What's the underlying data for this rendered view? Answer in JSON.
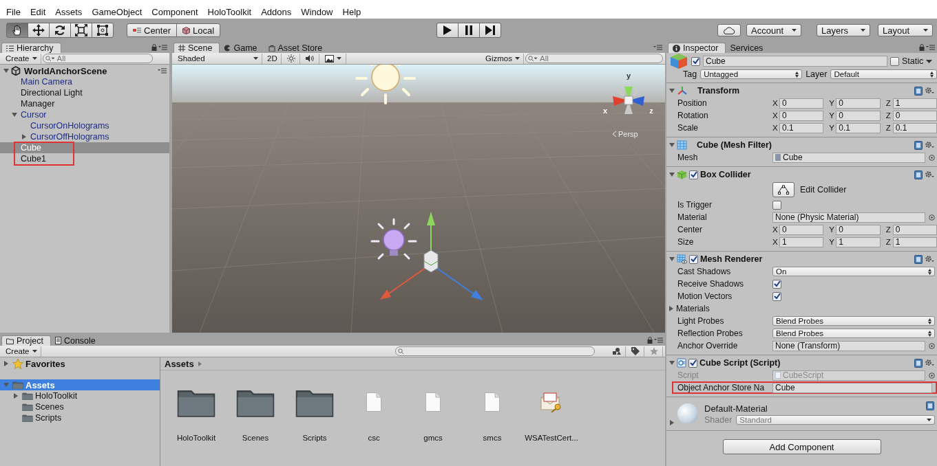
{
  "menu": [
    "File",
    "Edit",
    "Assets",
    "GameObject",
    "Component",
    "HoloToolkit",
    "Addons",
    "Window",
    "Help"
  ],
  "toolbar": {
    "tools": [
      {
        "kind": "hand",
        "selected": true
      },
      {
        "kind": "move",
        "selected": false
      },
      {
        "kind": "rotate",
        "selected": false
      },
      {
        "kind": "scale",
        "selected": false
      },
      {
        "kind": "rect",
        "selected": false
      }
    ],
    "pivot_buttons": [
      {
        "kind": "pivot",
        "label": "Center"
      },
      {
        "kind": "space",
        "label": "Local"
      }
    ],
    "playback": [
      {
        "kind": "play"
      },
      {
        "kind": "pause"
      },
      {
        "kind": "step"
      }
    ],
    "menus": [
      "Account",
      "Layers",
      "Layout"
    ]
  },
  "hierarchy": {
    "tab": "Hierarchy",
    "create": "Create",
    "search_placeholder": "All",
    "scene": "WorldAnchorScene",
    "items": [
      {
        "name": "Main Camera",
        "kind": "prefab",
        "selected": false,
        "outlined": false
      },
      {
        "name": "Directional Light",
        "kind": "object",
        "selected": false,
        "outlined": false
      },
      {
        "name": "Manager",
        "kind": "object",
        "selected": false,
        "outlined": false
      },
      {
        "name": "Cursor",
        "kind": "prefab",
        "selected": false,
        "outlined": false,
        "expanded": true,
        "children": [
          {
            "name": "CursorOnHolograms",
            "kind": "prefab",
            "selected": false,
            "outlined": false
          },
          {
            "name": "CursorOffHolograms",
            "kind": "prefab",
            "selected": false,
            "outlined": false,
            "expanded": false
          }
        ]
      },
      {
        "name": "Cube",
        "kind": "object",
        "selected": true,
        "outlined": true
      },
      {
        "name": "Cube1",
        "kind": "object",
        "selected": false,
        "outlined": true
      }
    ]
  },
  "scene": {
    "tabs": [
      {
        "label": "Scene",
        "kind": "scene",
        "selected": true
      },
      {
        "label": "Game",
        "kind": "game",
        "selected": false
      },
      {
        "label": "Asset Store",
        "kind": "store",
        "selected": false
      }
    ],
    "shading": "Shaded",
    "mode_2d": "2D",
    "gizmos": "Gizmos",
    "search_placeholder": "All",
    "gizmo": {
      "x": "x",
      "y": "y",
      "z": "z",
      "projection": "Persp"
    }
  },
  "inspector": {
    "tabs": [
      {
        "label": "Inspector",
        "selected": true
      },
      {
        "label": "Services",
        "selected": false
      }
    ],
    "object": {
      "active": true,
      "name": "Cube",
      "static": false,
      "static_label": "Static",
      "tag_label": "Tag",
      "tag": "Untagged",
      "layer_label": "Layer",
      "layer": "Default"
    },
    "components": [
      {
        "title": "Transform",
        "expanded": true,
        "rows": [
          {
            "kind": "vector3",
            "label": "Position",
            "values": [
              {
                "axis": "X",
                "value": "0"
              },
              {
                "axis": "Y",
                "value": "0"
              },
              {
                "axis": "Z",
                "value": "1"
              }
            ]
          },
          {
            "kind": "vector3",
            "label": "Rotation",
            "values": [
              {
                "axis": "X",
                "value": "0"
              },
              {
                "axis": "Y",
                "value": "0"
              },
              {
                "axis": "Z",
                "value": "0"
              }
            ]
          },
          {
            "kind": "vector3",
            "label": "Scale",
            "values": [
              {
                "axis": "X",
                "value": "0.1"
              },
              {
                "axis": "Y",
                "value": "0.1"
              },
              {
                "axis": "Z",
                "value": "0.1"
              }
            ]
          }
        ]
      },
      {
        "title": "Cube (Mesh Filter)",
        "expanded": true,
        "rows": [
          {
            "kind": "object",
            "label": "Mesh",
            "value": "Cube",
            "disabled": false
          }
        ]
      },
      {
        "title": "Box Collider",
        "enabled": true,
        "expanded": true,
        "rows": [
          {
            "kind": "button",
            "label": "Edit Collider"
          },
          {
            "kind": "checkbox",
            "label": "Is Trigger",
            "checked": false
          },
          {
            "kind": "object",
            "label": "Material",
            "value": "None (Physic Material)",
            "disabled": false
          },
          {
            "kind": "vector3",
            "label": "Center",
            "values": [
              {
                "axis": "X",
                "value": "0"
              },
              {
                "axis": "Y",
                "value": "0"
              },
              {
                "axis": "Z",
                "value": "0"
              }
            ]
          },
          {
            "kind": "vector3",
            "label": "Size",
            "values": [
              {
                "axis": "X",
                "value": "1"
              },
              {
                "axis": "Y",
                "value": "1"
              },
              {
                "axis": "Z",
                "value": "1"
              }
            ]
          }
        ]
      },
      {
        "title": "Mesh Renderer",
        "enabled": true,
        "expanded": true,
        "rows": [
          {
            "kind": "dropdown",
            "label": "Cast Shadows",
            "value": "On"
          },
          {
            "kind": "checkbox",
            "label": "Receive Shadows",
            "checked": true
          },
          {
            "kind": "checkbox",
            "label": "Motion Vectors",
            "checked": true
          },
          {
            "kind": "foldout",
            "label": "Materials",
            "expanded": false
          },
          {
            "kind": "dropdown",
            "label": "Light Probes",
            "value": "Blend Probes"
          },
          {
            "kind": "dropdown",
            "label": "Reflection Probes",
            "value": "Blend Probes"
          },
          {
            "kind": "object",
            "label": "Anchor Override",
            "value": "None (Transform)",
            "disabled": false
          }
        ]
      },
      {
        "title": "Cube Script (Script)",
        "enabled": true,
        "expanded": true,
        "rows": [
          {
            "kind": "object",
            "label": "Script",
            "value": "CubeScript",
            "disabled": true
          },
          {
            "kind": "text",
            "label": "Object Anchor Store Na",
            "value": "Cube",
            "outlined": true
          }
        ]
      }
    ],
    "material": {
      "name": "Default-Material",
      "shader_label": "Shader",
      "shader": "Standard",
      "expanded": false
    },
    "add_component": "Add Component"
  },
  "project": {
    "tabs": [
      {
        "label": "Project",
        "selected": true
      },
      {
        "label": "Console",
        "selected": false
      }
    ],
    "create": "Create",
    "tree": [
      {
        "name": "Favorites",
        "kind": "favorites",
        "expanded": false,
        "selected": false
      },
      {
        "name": "Assets",
        "kind": "folder",
        "expanded": true,
        "selected": true,
        "children": [
          {
            "name": "HoloToolkit",
            "kind": "folder",
            "expanded": false,
            "selected": false
          },
          {
            "name": "Scenes",
            "kind": "folder",
            "selected": false
          },
          {
            "name": "Scripts",
            "kind": "folder",
            "selected": false
          }
        ]
      }
    ],
    "breadcrumb": "Assets",
    "assets": [
      {
        "name": "HoloToolkit",
        "kind": "folder"
      },
      {
        "name": "Scenes",
        "kind": "folder"
      },
      {
        "name": "Scripts",
        "kind": "folder"
      },
      {
        "name": "csc",
        "kind": "file"
      },
      {
        "name": "gmcs",
        "kind": "file"
      },
      {
        "name": "smcs",
        "kind": "file"
      },
      {
        "name": "WSATestCert...",
        "kind": "certificate"
      }
    ]
  }
}
